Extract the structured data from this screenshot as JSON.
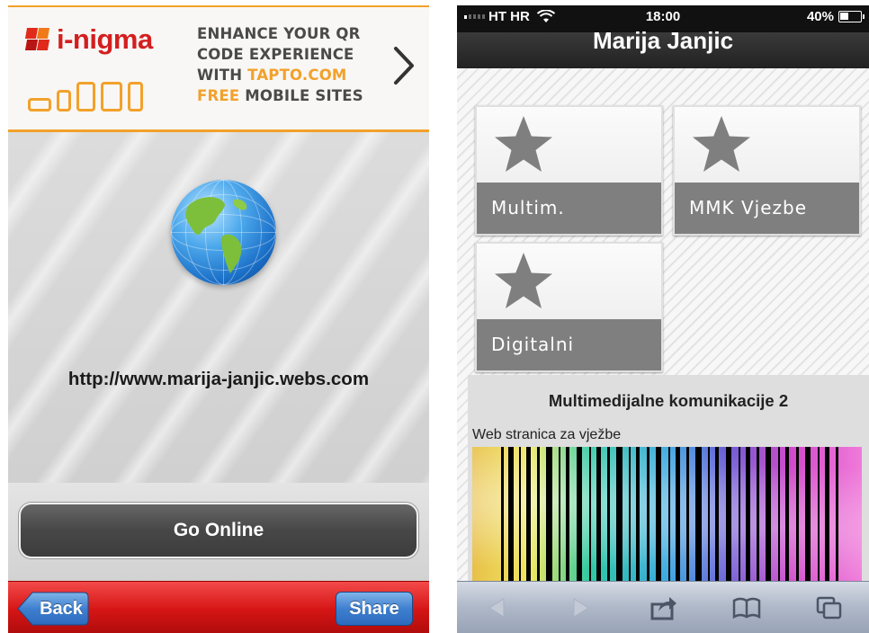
{
  "left_app": {
    "logo_text": "i-nigma",
    "banner": {
      "line1": "ENHANCE YOUR QR",
      "line2": "CODE EXPERIENCE",
      "line3_prefix": "WITH ",
      "line3_highlight": "TAPTO.COM",
      "line4_highlight": "FREE",
      "line4_rest": " MOBILE SITES"
    },
    "url": "http://www.marija-janjic.webs.com",
    "go_online_label": "Go Online",
    "back_label": "Back",
    "share_label": "Share"
  },
  "right_app": {
    "status": {
      "carrier": "HT HR",
      "time": "18:00",
      "battery": "40%"
    },
    "site_title": "Marija Janjic",
    "tiles": [
      {
        "label": "Multim."
      },
      {
        "label": "MMK Vjezbe"
      },
      {
        "label": "Digitalni"
      }
    ],
    "content": {
      "title": "Multimedijalne komunikacije 2",
      "subtitle": "Web stranica za vježbe"
    },
    "toolbar_icons": [
      "back-arrow-icon",
      "forward-arrow-icon",
      "share-icon",
      "bookmarks-icon",
      "pages-icon"
    ]
  },
  "colors": {
    "inigma_red": "#d41f1f",
    "banner_orange": "#f2a12b",
    "toolbar_red": "#d51515",
    "share_blue": "#3f7fd0",
    "tile_gray": "#7f7f7f"
  }
}
